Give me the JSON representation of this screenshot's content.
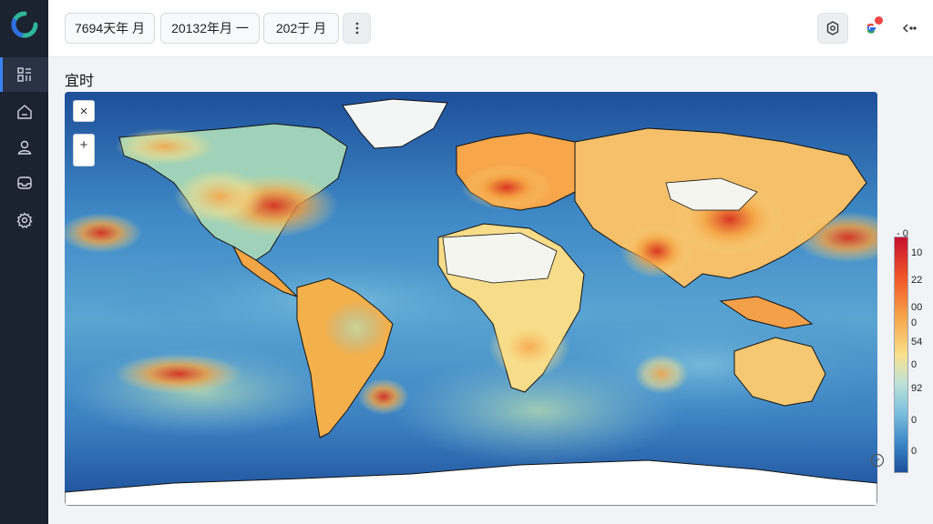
{
  "toolbar": {
    "filters": [
      {
        "label": "7694天年 月"
      },
      {
        "label": "20132年月  一"
      },
      {
        "label": "202于 月"
      }
    ]
  },
  "page": {
    "title": "宜时"
  },
  "icons": {
    "logo": "app-logo",
    "nav": [
      "dashboard-icon",
      "home-icon",
      "user-icon",
      "inbox-icon",
      "settings-icon"
    ],
    "more": "more-vertical-icon",
    "settings": "settings-gear-icon",
    "google": "google-account-icon",
    "share": "share-icon"
  },
  "map": {
    "controls": {
      "close": "×",
      "zoom_in": "+"
    },
    "legend": {
      "top_mark": "- 0",
      "ticks": [
        "10",
        "22",
        "00",
        "0",
        "54",
        "0",
        "92",
        "0",
        "0"
      ]
    }
  },
  "colors": {
    "sidebar": "#1b2230",
    "ocean": "#1d4f9a",
    "hot": "#c8102e",
    "warm": "#f7a64a",
    "mild": "#f8e08c",
    "cool": "#7ec2de",
    "land_dry": "#f5f5f0"
  }
}
